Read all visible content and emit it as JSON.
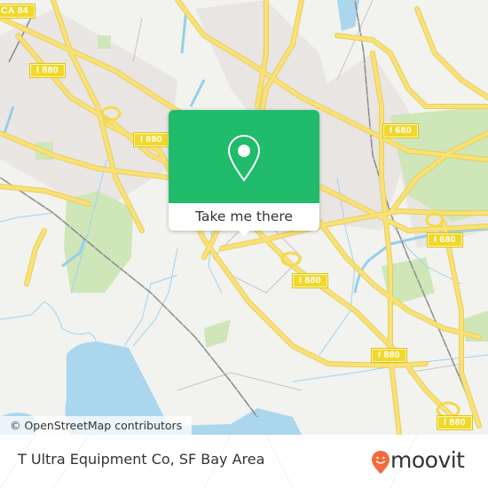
{
  "map": {
    "highway_shields": [
      {
        "label": "I 880",
        "id": "i880-a"
      },
      {
        "label": "I 880",
        "id": "i880-b"
      },
      {
        "label": "I 880",
        "id": "i880-c"
      },
      {
        "label": "I 880",
        "id": "i880-d"
      },
      {
        "label": "I 880",
        "id": "i880-e"
      },
      {
        "label": "I 680",
        "id": "i680-a"
      },
      {
        "label": "I 680",
        "id": "i680-b"
      },
      {
        "label": "CA 84",
        "id": "ca84"
      }
    ],
    "attribution": "© OpenStreetMap contributors"
  },
  "popup": {
    "icon": "location-pin-icon",
    "button_label": "Take me there"
  },
  "footer": {
    "place_title": "T Ultra Equipment Co, SF Bay Area",
    "brand": "moovit",
    "brand_color": "#f26a3d",
    "accent_color": "#20bb6b"
  }
}
